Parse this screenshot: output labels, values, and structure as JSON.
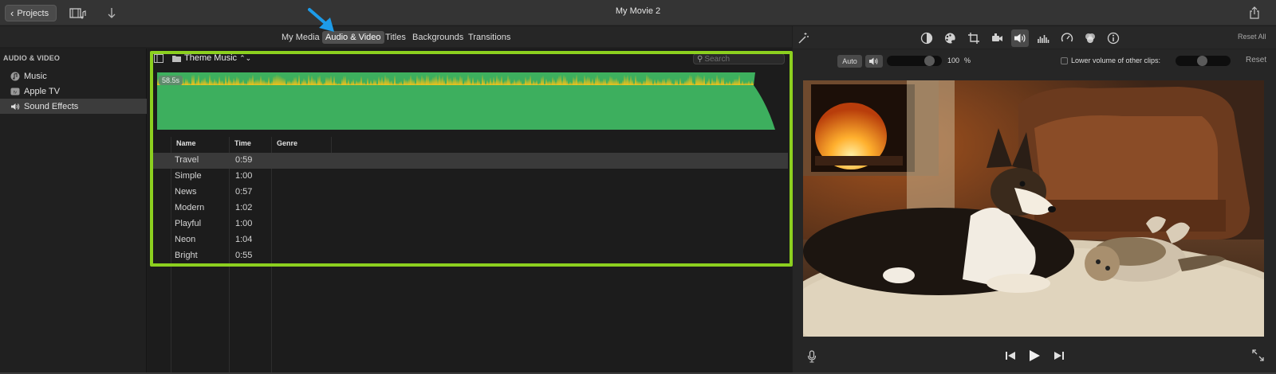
{
  "titlebar": {
    "projects_label": "Projects",
    "movie_title": "My Movie 2"
  },
  "browser_tabs": [
    "My Media",
    "Audio & Video",
    "Titles",
    "Backgrounds",
    "Transitions"
  ],
  "selected_tab": "Audio & Video",
  "sidebar": {
    "header": "AUDIO & VIDEO",
    "items": [
      {
        "label": "Music",
        "icon": "music-note-icon",
        "selected": false
      },
      {
        "label": "Apple TV",
        "icon": "apple-tv-icon",
        "selected": false
      },
      {
        "label": "Sound Effects",
        "icon": "speaker-icon",
        "selected": true
      }
    ]
  },
  "browser": {
    "collection_label": "Theme Music",
    "search_placeholder": "Search",
    "waveform_duration_badge": "58.5s",
    "columns": [
      "Name",
      "Time",
      "Genre"
    ],
    "rows": [
      {
        "name": "Travel",
        "time": "0:59",
        "genre": "",
        "selected": true
      },
      {
        "name": "Simple",
        "time": "1:00",
        "genre": ""
      },
      {
        "name": "News",
        "time": "0:57",
        "genre": ""
      },
      {
        "name": "Modern",
        "time": "1:02",
        "genre": ""
      },
      {
        "name": "Playful",
        "time": "1:00",
        "genre": ""
      },
      {
        "name": "Neon",
        "time": "1:04",
        "genre": ""
      },
      {
        "name": "Bright",
        "time": "0:55",
        "genre": ""
      }
    ]
  },
  "viewer": {
    "reset_all_label": "Reset All",
    "auto_label": "Auto",
    "volume_value": "100",
    "volume_unit": "%",
    "volume_level": 1.0,
    "lower_volume_label": "Lower volume of other clips:",
    "lower_volume_checked": false,
    "reset_label": "Reset",
    "toolbar_icons": [
      "color-balance-icon",
      "color-correction-icon",
      "crop-icon",
      "stabilization-icon",
      "volume-icon",
      "noise-reduction-icon",
      "speed-icon",
      "clip-filter-icon",
      "info-icon"
    ],
    "active_tool": "volume-icon"
  },
  "colors": {
    "highlight": "#8cd01f",
    "waveform_green": "#3daf5e",
    "waveform_yellow": "#f2c21b",
    "annotation_arrow": "#1d9be8"
  }
}
